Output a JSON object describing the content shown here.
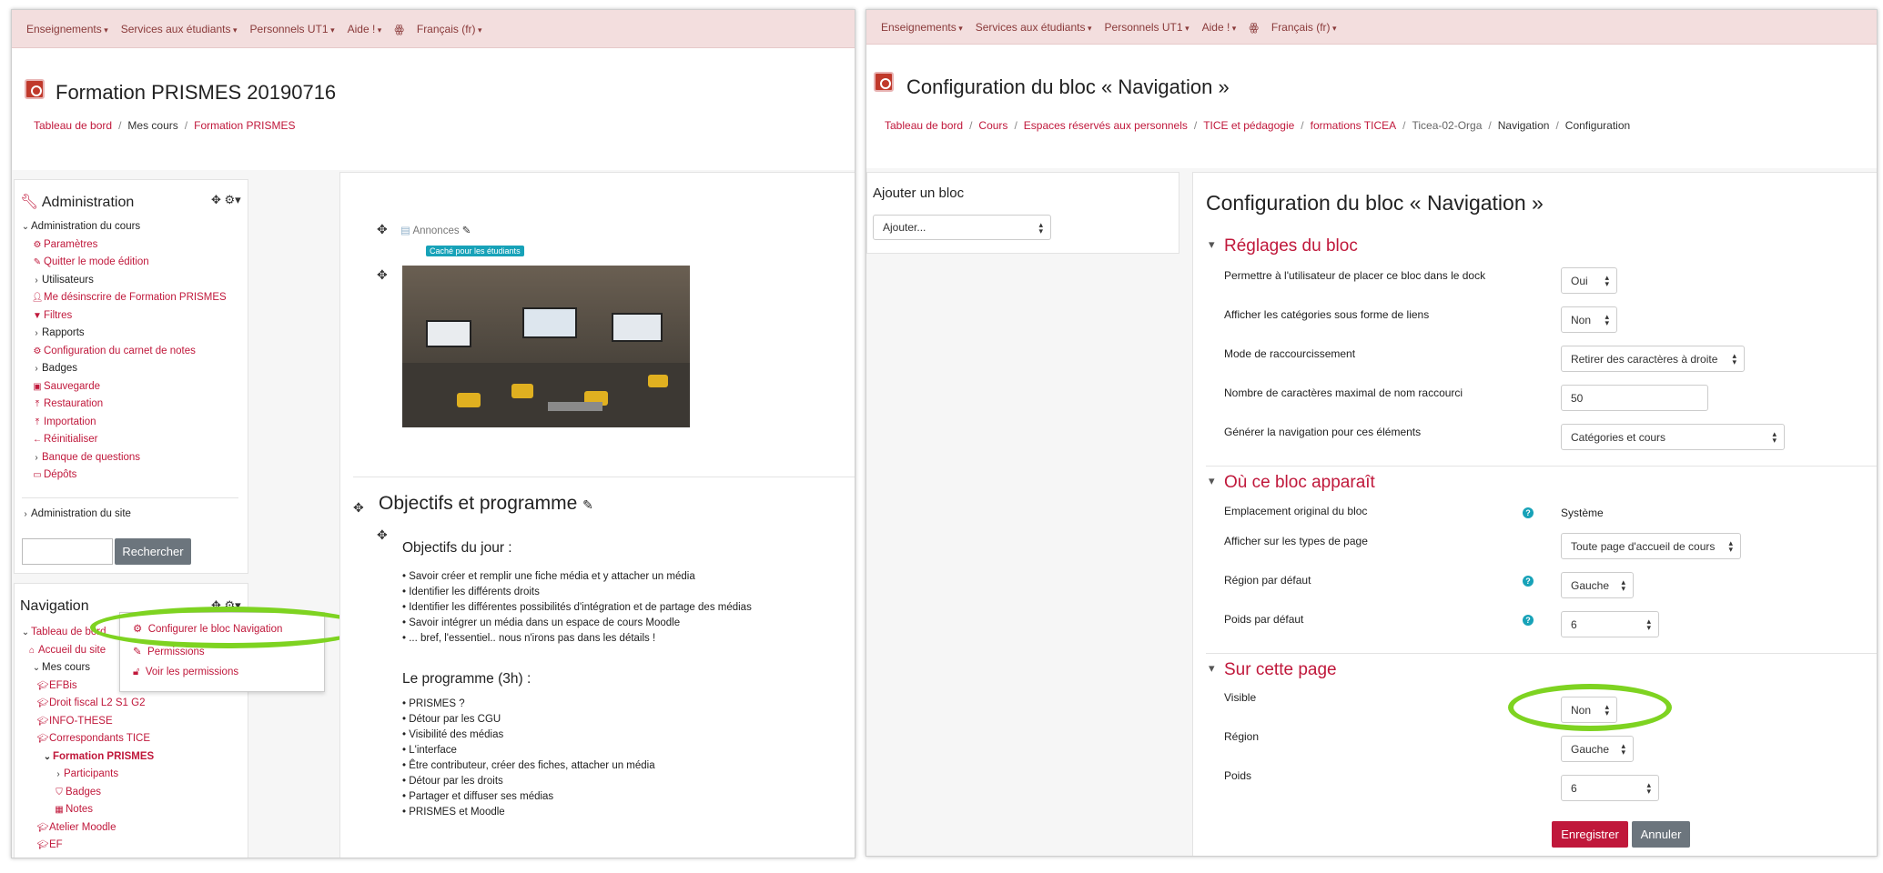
{
  "left": {
    "topnav": [
      "Enseignements",
      "Services aux étudiants",
      "Personnels UT1",
      "Aide !",
      "Français (fr)"
    ],
    "title": "Formation PRISMES 20190716",
    "breadcrumb": [
      "Tableau de bord",
      "Mes cours",
      "Formation PRISMES"
    ],
    "admin_block": {
      "title": "Administration",
      "items": [
        "Administration du cours",
        "Paramètres",
        "Quitter le mode édition",
        "Utilisateurs",
        "Me désinscrire de Formation PRISMES",
        "Filtres",
        "Rapports",
        "Configuration du carnet de notes",
        "Badges",
        "Sauvegarde",
        "Restauration",
        "Importation",
        "Réinitialiser",
        "Banque de questions",
        "Dépôts"
      ],
      "site_admin": "Administration du site",
      "search_button": "Rechercher"
    },
    "nav_block": {
      "title": "Navigation",
      "items": [
        "Tableau de bord",
        "Accueil du site",
        "Mes cours",
        "EFBis",
        "Droit fiscal L2 S1 G2",
        "INFO-THESE",
        "Correspondants TICE",
        "Formation PRISMES",
        "Participants",
        "Badges",
        "Notes",
        "Atelier Moodle",
        "EF"
      ],
      "menu": [
        "Configurer le bloc Navigation",
        "Permissions",
        "Voir les permissions"
      ]
    },
    "content": {
      "annonces": "Annonces",
      "badge": "Caché pour les étudiants",
      "section_title": "Objectifs et programme",
      "obj_title": "Objectifs du jour :",
      "objectives": [
        "Savoir créer et remplir une fiche média et y attacher un média",
        "Identifier les différents droits",
        "Identifier les différentes possibilités d'intégration et de partage des médias",
        "Savoir intégrer un média dans un espace de cours Moodle",
        "... bref, l'essentiel.. nous n'irons pas dans les détails !"
      ],
      "prog_title": "Le programme (3h) :",
      "program": [
        "PRISMES ?",
        "Détour par les CGU",
        "Visibilité des médias",
        "L'interface",
        "Être contributeur, créer des fiches, attacher un média",
        "Détour par les droits",
        "Partager et diffuser ses médias",
        "PRISMES et Moodle"
      ]
    }
  },
  "right": {
    "topnav": [
      "Enseignements",
      "Services aux étudiants",
      "Personnels UT1",
      "Aide !",
      "Français (fr)"
    ],
    "title": "Configuration du bloc « Navigation »",
    "breadcrumb": [
      "Tableau de bord",
      "Cours",
      "Espaces réservés aux personnels",
      "TICE et pédagogie",
      "formations TICEA",
      "Ticea-02-Orga",
      "Navigation",
      "Configuration"
    ],
    "add_block": {
      "title": "Ajouter un bloc",
      "select": "Ajouter..."
    },
    "form": {
      "title": "Configuration du bloc « Navigation »",
      "sec1": "Réglages du bloc",
      "dock_label": "Permettre à l'utilisateur de placer ce bloc dans le dock",
      "dock_value": "Oui",
      "links_label": "Afficher les catégories sous forme de liens",
      "links_value": "Non",
      "trim_label": "Mode de raccourcissement",
      "trim_value": "Retirer des caractères à droite",
      "maxchars_label": "Nombre de caractères maximal de nom raccourci",
      "maxchars_value": "50",
      "gen_label": "Générer la navigation pour ces éléments",
      "gen_value": "Catégories et cours",
      "sec2": "Où ce bloc apparaît",
      "orig_label": "Emplacement original du bloc",
      "orig_value": "Système",
      "pagetypes_label": "Afficher sur les types de page",
      "pagetypes_value": "Toute page d'accueil de cours",
      "defregion_label": "Région par défaut",
      "defregion_value": "Gauche",
      "defweight_label": "Poids par défaut",
      "defweight_value": "6",
      "sec3": "Sur cette page",
      "visible_label": "Visible",
      "visible_value": "Non",
      "region_label": "Région",
      "region_value": "Gauche",
      "weight_label": "Poids",
      "weight_value": "6",
      "save": "Enregistrer",
      "cancel": "Annuler"
    }
  },
  "colors": {
    "accent": "#c0183b",
    "topnav_bg": "#f3dede",
    "highlight": "#7ed321"
  }
}
